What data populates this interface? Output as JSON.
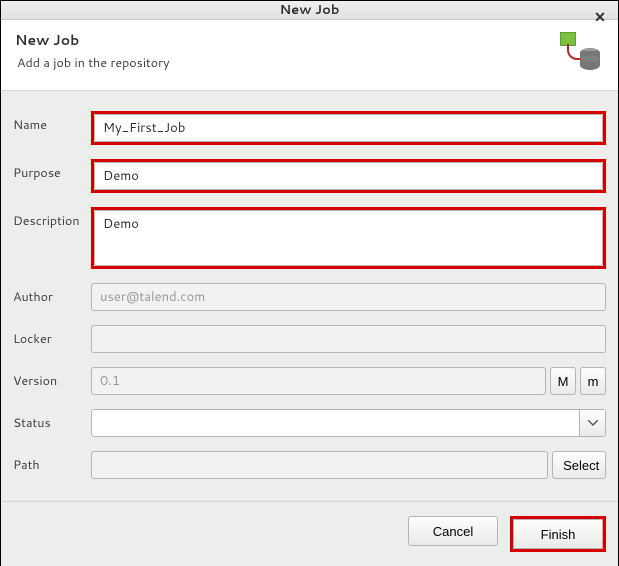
{
  "window": {
    "title": "New Job"
  },
  "header": {
    "title": "New Job",
    "subtitle": "Add a job in the repository"
  },
  "labels": {
    "name": "Name",
    "purpose": "Purpose",
    "description": "Description",
    "author": "Author",
    "locker": "Locker",
    "version": "Version",
    "status": "Status",
    "path": "Path"
  },
  "fields": {
    "name": "My_First_Job",
    "purpose": "Demo",
    "description": "Demo",
    "author": "user@talend.com",
    "locker": "",
    "version": "0.1",
    "status": "",
    "path": ""
  },
  "buttons": {
    "version_major": "M",
    "version_minor": "m",
    "select": "Select",
    "cancel": "Cancel",
    "finish": "Finish"
  }
}
